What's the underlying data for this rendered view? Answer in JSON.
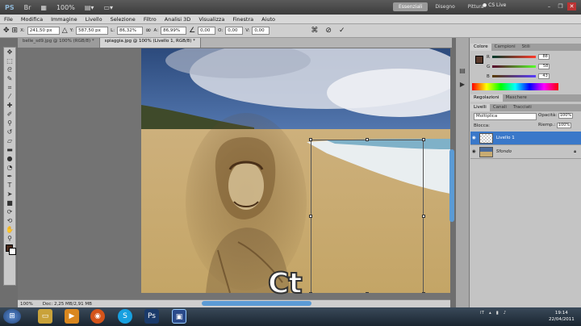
{
  "app": {
    "logo": "PS",
    "workspaces": [
      "Essenziali",
      "Disegno",
      "Pittura"
    ],
    "active_workspace": "Essenziali",
    "cs_live": "CS Live",
    "icons": [
      "bridge-icon",
      "minibridge-icon",
      "zoom-level-icon",
      "arrange-icon",
      "screen-mode-icon"
    ],
    "zoom": "100%"
  },
  "menu": [
    "File",
    "Modifica",
    "Immagine",
    "Livello",
    "Selezione",
    "Filtro",
    "Analisi 3D",
    "Visualizza",
    "Finestra",
    "Aiuto"
  ],
  "options": {
    "x_label": "X:",
    "x": "241,50 px",
    "y_label": "Y:",
    "y": "587,50 px",
    "w_label": "L:",
    "w": "86,32%",
    "h_label": "A:",
    "h": "86,99%",
    "angle": "0,00",
    "h_skew_label": "O:",
    "h_skew": "0,00",
    "v_skew_label": "V:",
    "v_skew": "0,00"
  },
  "doc_tabs": [
    {
      "label": "belle_sd9.jpg @ 100% (RGB/8) *"
    },
    {
      "label": "spiaggia.jpg @ 100% (Livello 1, RGB/8) *"
    }
  ],
  "status": {
    "zoom": "100%",
    "doc": "Doc: 2,25 MB/2,91 MB"
  },
  "color_panel": {
    "tabs": [
      "Colore",
      "Campioni",
      "Stili"
    ],
    "r_label": "R",
    "r": "88",
    "g_label": "G",
    "g": "58",
    "b_label": "B",
    "b": "43"
  },
  "adjust_panel": {
    "tabs": [
      "Regolazioni",
      "Maschere"
    ]
  },
  "layers_panel": {
    "tabs": [
      "Livelli",
      "Canali",
      "Tracciati"
    ],
    "blend": "Moltiplica",
    "opacity_label": "Opacità:",
    "opacity": "100%",
    "fill_label": "Riemp.:",
    "fill": "100%",
    "lock_label": "Blocca:",
    "layers": [
      {
        "name": "Livello 1",
        "selected": true
      },
      {
        "name": "Sfondo",
        "selected": false
      }
    ]
  },
  "taskbar": {
    "lang": "IT",
    "time": "19:14",
    "date": "22/04/2011",
    "apps": [
      "explorer",
      "media",
      "firefox",
      "skype",
      "photoshop",
      "app"
    ]
  },
  "overlay": {
    "text": "Ct"
  }
}
